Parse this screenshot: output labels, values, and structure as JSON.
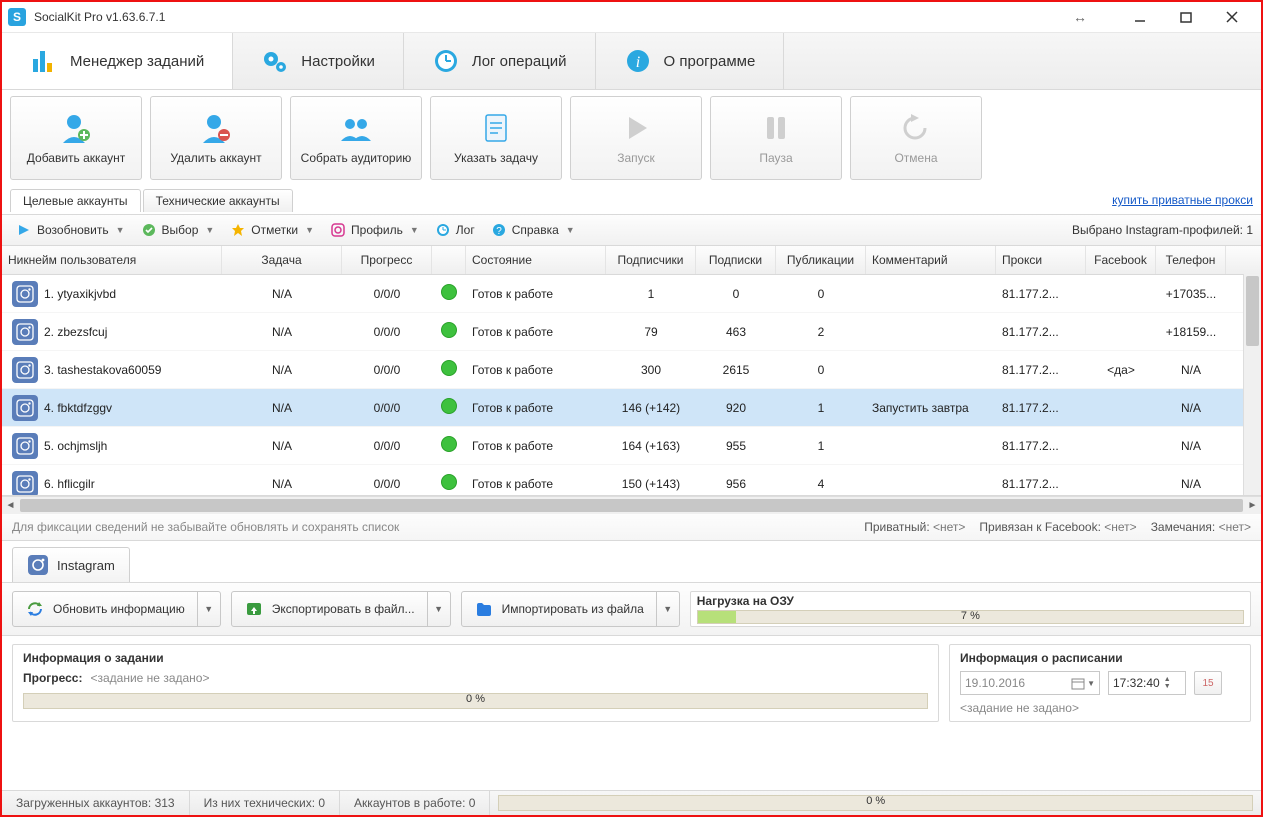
{
  "window": {
    "title": "SocialKit Pro v1.63.6.7.1"
  },
  "main_tabs": {
    "manager": "Менеджер заданий",
    "settings": "Настройки",
    "log": "Лог операций",
    "about": "О программе"
  },
  "big_buttons": {
    "add": "Добавить аккаунт",
    "del": "Удалить аккаунт",
    "gather": "Собрать аудиторию",
    "task": "Указать задачу",
    "start": "Запуск",
    "pause": "Пауза",
    "cancel": "Отмена"
  },
  "sub_tabs": {
    "target": "Целевые аккаунты",
    "tech": "Технические аккаунты"
  },
  "buy_proxy": "купить приватные прокси",
  "small_toolbar": {
    "resume": "Возобновить",
    "select": "Выбор",
    "marks": "Отметки",
    "profile": "Профиль",
    "log": "Лог",
    "help": "Справка",
    "selected": "Выбрано Instagram-профилей: 1"
  },
  "columns": {
    "nick": "Никнейм пользователя",
    "task": "Задача",
    "progress": "Прогресс",
    "state": "Состояние",
    "subscribers": "Подписчики",
    "follows": "Подписки",
    "posts": "Публикации",
    "comment": "Комментарий",
    "proxy": "Прокси",
    "facebook": "Facebook",
    "phone": "Телефон"
  },
  "rows": [
    {
      "nick": "1. ytyaxikjvbd",
      "task": "N/A",
      "progress": "0/0/0",
      "state": "Готов к работе",
      "subs": "1",
      "foll": "0",
      "posts": "0",
      "comment": "",
      "proxy": "81.177.2...",
      "fb": "",
      "phone": "+17035..."
    },
    {
      "nick": "2. zbezsfcuj",
      "task": "N/A",
      "progress": "0/0/0",
      "state": "Готов к работе",
      "subs": "79",
      "foll": "463",
      "posts": "2",
      "comment": "",
      "proxy": "81.177.2...",
      "fb": "",
      "phone": "+18159..."
    },
    {
      "nick": "3. tashestakova60059",
      "task": "N/A",
      "progress": "0/0/0",
      "state": "Готов к работе",
      "subs": "300",
      "foll": "2615",
      "posts": "0",
      "comment": "",
      "proxy": "81.177.2...",
      "fb": "<да>",
      "phone": "N/A"
    },
    {
      "nick": "4. fbktdfzggv",
      "task": "N/A",
      "progress": "0/0/0",
      "state": "Готов к работе",
      "subs": "146 (+142)",
      "foll": "920",
      "posts": "1",
      "comment": "Запустить завтра",
      "proxy": "81.177.2...",
      "fb": "",
      "phone": "N/A",
      "selected": true
    },
    {
      "nick": "5. ochjmsljh",
      "task": "N/A",
      "progress": "0/0/0",
      "state": "Готов к работе",
      "subs": "164 (+163)",
      "foll": "955",
      "posts": "1",
      "comment": "",
      "proxy": "81.177.2...",
      "fb": "",
      "phone": "N/A"
    },
    {
      "nick": "6. hflicgilr",
      "task": "N/A",
      "progress": "0/0/0",
      "state": "Готов к работе",
      "subs": "150 (+143)",
      "foll": "956",
      "posts": "4",
      "comment": "",
      "proxy": "81.177.2...",
      "fb": "",
      "phone": "N/A"
    }
  ],
  "hint": "Для фиксации сведений не забывайте обновлять и сохранять список",
  "status_flags": {
    "private_label": "Приватный:",
    "private_val": "<нет>",
    "fb_label": "Привязан к Facebook:",
    "fb_val": "<нет>",
    "notes_label": "Замечания:",
    "notes_val": "<нет>"
  },
  "instagram_tab": "Instagram",
  "action_buttons": {
    "refresh": "Обновить информацию",
    "export": "Экспортировать в файл...",
    "import": "Импортировать из файла"
  },
  "ram": {
    "title": "Нагрузка на ОЗУ",
    "percent": 7,
    "label": "7 %"
  },
  "task_panel": {
    "title": "Информация о задании",
    "progress_label": "Прогресс:",
    "progress_value": "<задание не задано>",
    "bar_label": "0 %"
  },
  "schedule_panel": {
    "title": "Информация о расписании",
    "date": "19.10.2016",
    "time": "17:32:40",
    "state": "<задание не задано>"
  },
  "statusbar": {
    "loaded": "Загруженных аккаунтов: 313",
    "tech": "Из них технических: 0",
    "working": "Аккаунтов в работе: 0",
    "bar_label": "0 %"
  }
}
